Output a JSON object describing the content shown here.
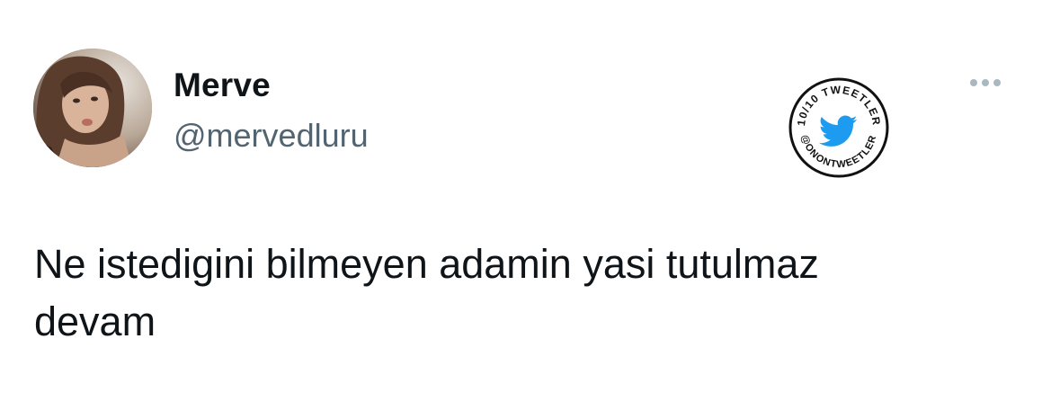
{
  "tweet": {
    "author": {
      "display_name": "Merve",
      "handle": "@mervedluru",
      "avatar_icon": "profile-photo"
    },
    "text": "Ne istedigini bilmeyen adamin yasi tutulmaz\ndevam",
    "more_icon": "more-horizontal-icon"
  },
  "watermark": {
    "top_text": "10/10 TWEETLER",
    "bottom_text": "@ONONTWEETLER",
    "icon": "twitter-bird-icon"
  },
  "colors": {
    "text_primary": "#0f1419",
    "text_secondary": "#536471",
    "twitter_blue": "#1d9bf0",
    "more_dots": "#aab8c2"
  }
}
